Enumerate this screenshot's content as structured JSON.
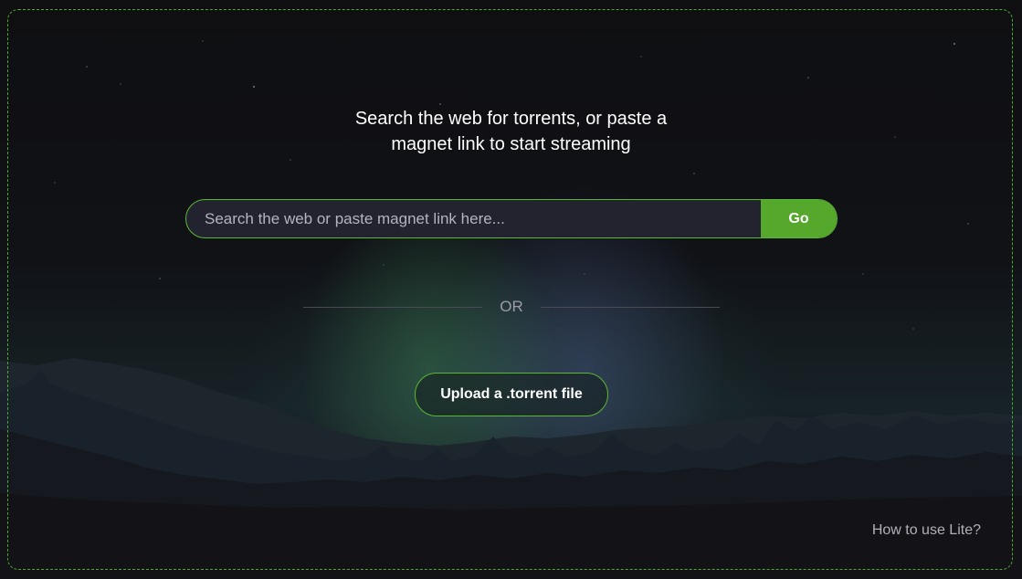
{
  "headline": {
    "line1": "Search the web for torrents, or paste a",
    "line2": "magnet link to start streaming"
  },
  "search": {
    "placeholder": "Search the web or paste magnet link here...",
    "value": "",
    "go_label": "Go"
  },
  "divider": {
    "label": "OR"
  },
  "upload": {
    "label": "Upload a .torrent file"
  },
  "footer": {
    "help_link": "How to use Lite?"
  },
  "colors": {
    "accent": "#55a82c",
    "background": "#121215",
    "input_background": "#232330"
  }
}
